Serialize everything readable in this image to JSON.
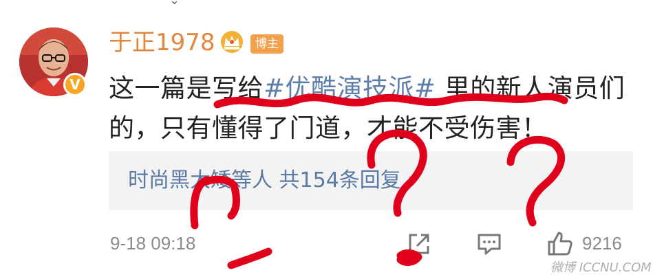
{
  "post": {
    "author": "于正1978",
    "role_badge": "博主",
    "verified_badge": "V",
    "text_before_tag": "这一篇是写给",
    "hashtag": "#优酷演技派#",
    "text_after_tag": " 里的新人演员们的，只有懂得了门道，才能不受伤害！",
    "replies_summary": "时尚黑大矮等人 共154条回复 ›",
    "timestamp": "9-18 09:18",
    "like_count": "9216",
    "watermark": "微博 ICCNU.COM"
  },
  "colors": {
    "author": "#e3853b",
    "hashtag": "#5d7ea8",
    "replies_link": "#5b7aa3",
    "meta": "#8b8b8b",
    "annotation": "#e0001b"
  },
  "icons": [
    "chevron-down-icon",
    "crown-icon",
    "share-icon",
    "comment-icon",
    "like-icon"
  ]
}
